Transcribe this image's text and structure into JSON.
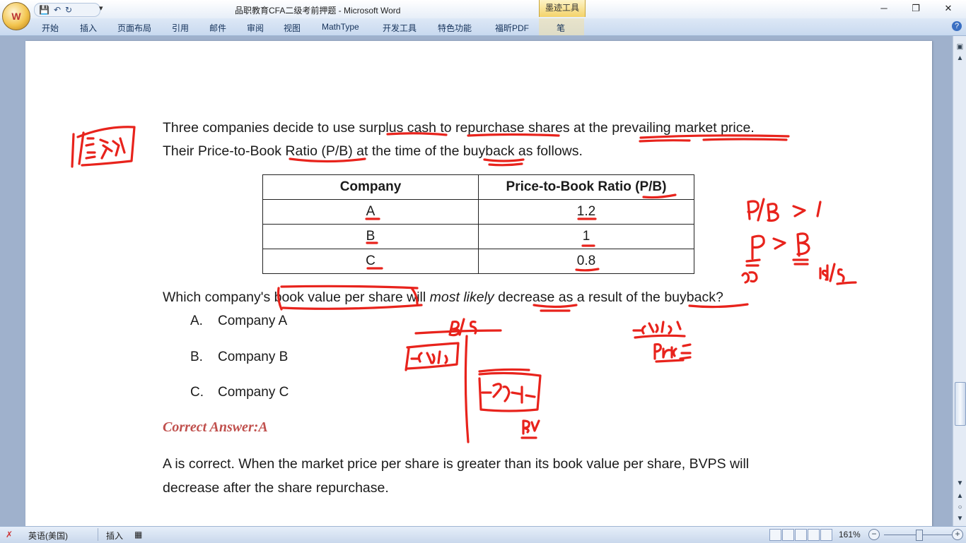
{
  "window": {
    "title": "品职教育CFA二级考前押题 - Microsoft Word",
    "contextual_tab": "墨迹工具",
    "minimize": "─",
    "restore": "❐",
    "close": "✕"
  },
  "ribbon": {
    "tabs": [
      "开始",
      "插入",
      "页面布局",
      "引用",
      "邮件",
      "审阅",
      "视图",
      "MathType",
      "开发工具",
      "特色功能",
      "福昕PDF",
      "笔"
    ]
  },
  "document": {
    "intro_line1": "Three companies decide to use surplus cash to repurchase shares at the prevailing market price.",
    "intro_line2": "Their Price-to-Book Ratio (P/B) at the time of the buyback as follows.",
    "table": {
      "headers": [
        "Company",
        "Price-to-Book Ratio (P/B)"
      ],
      "rows": [
        [
          "A",
          "1.2"
        ],
        [
          "B",
          "1"
        ],
        [
          "C",
          "0.8"
        ]
      ]
    },
    "question": {
      "before": "Which company's book value per share will ",
      "italic": "most likely",
      "after": " decrease as a result of the buyback?"
    },
    "options": [
      {
        "letter": "A.",
        "text": "Company A"
      },
      {
        "letter": "B.",
        "text": "Company B"
      },
      {
        "letter": "C.",
        "text": "Company C"
      }
    ],
    "correct_answer": "Correct Answer:A",
    "explanation_line1": "A is correct. When the market price per share is greater than its book value per share, BVPS will",
    "explanation_line2": "decrease after the share repurchase."
  },
  "status_bar": {
    "language": "英语(美国)",
    "mode": "插入",
    "zoom": "161%"
  },
  "colors": {
    "ink": "#e8231c",
    "correct_answer": "#c0504d",
    "ribbon": "#c8d9ef"
  }
}
